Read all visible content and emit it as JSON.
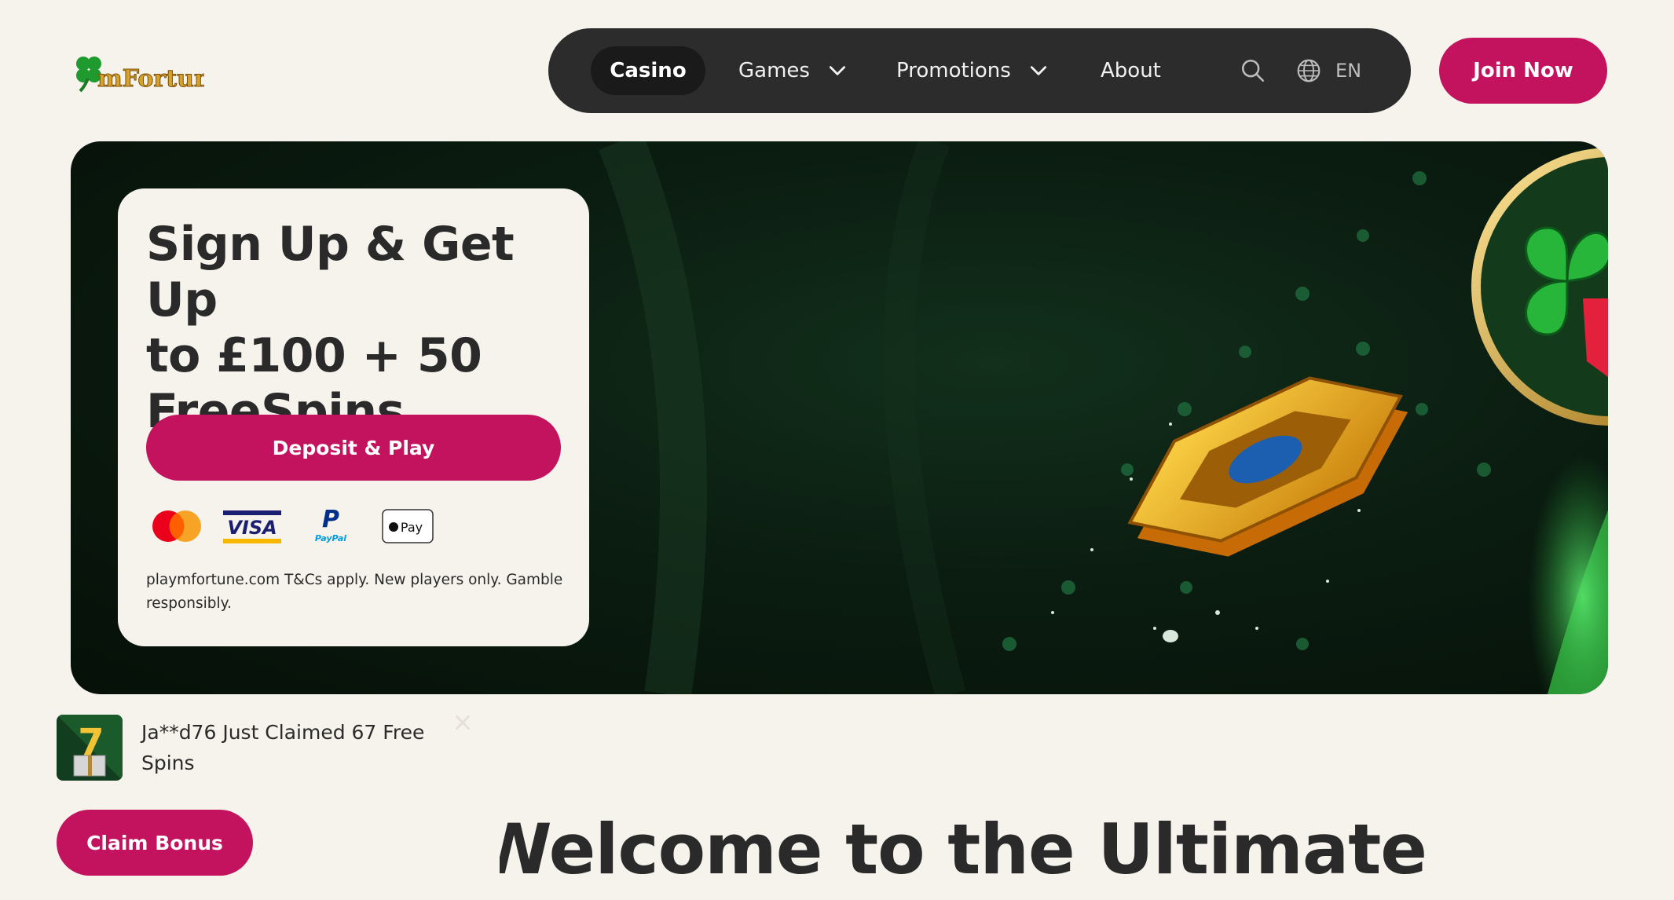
{
  "logo": {
    "text": "mFortune",
    "icon": "four-leaf-clover-icon"
  },
  "nav": {
    "items": [
      {
        "label": "Casino",
        "active": true
      },
      {
        "label": "Games",
        "dropdown": true
      },
      {
        "label": "Promotions",
        "dropdown": true
      },
      {
        "label": "About"
      }
    ],
    "language": "EN",
    "icons": [
      "search-icon",
      "globe-icon",
      "chevron-down-icon"
    ]
  },
  "header": {
    "join_label": "Join Now"
  },
  "promo": {
    "title_line1": "Sign Up & Get Up",
    "title_line2": "to £100 + 50",
    "title_line3": "FreeSpins",
    "deposit_label": "Deposit & Play",
    "payment_methods": [
      "Mastercard",
      "VISA",
      "PayPal",
      "Apple Pay"
    ],
    "terms": "playmfortune.com T&Cs apply. New players only. Gamble responsibly."
  },
  "claim_notification": {
    "text": "Ja**d76 Just Claimed 67 Free Spins"
  },
  "claim_button_label": "Claim Bonus",
  "welcome_heading": "Welcome to the Ultimate",
  "colors": {
    "accent": "#c3135e",
    "nav_bg": "#2c2c2c",
    "page_bg": "#f6f2ec",
    "hero_bg": "#0b1d11"
  }
}
